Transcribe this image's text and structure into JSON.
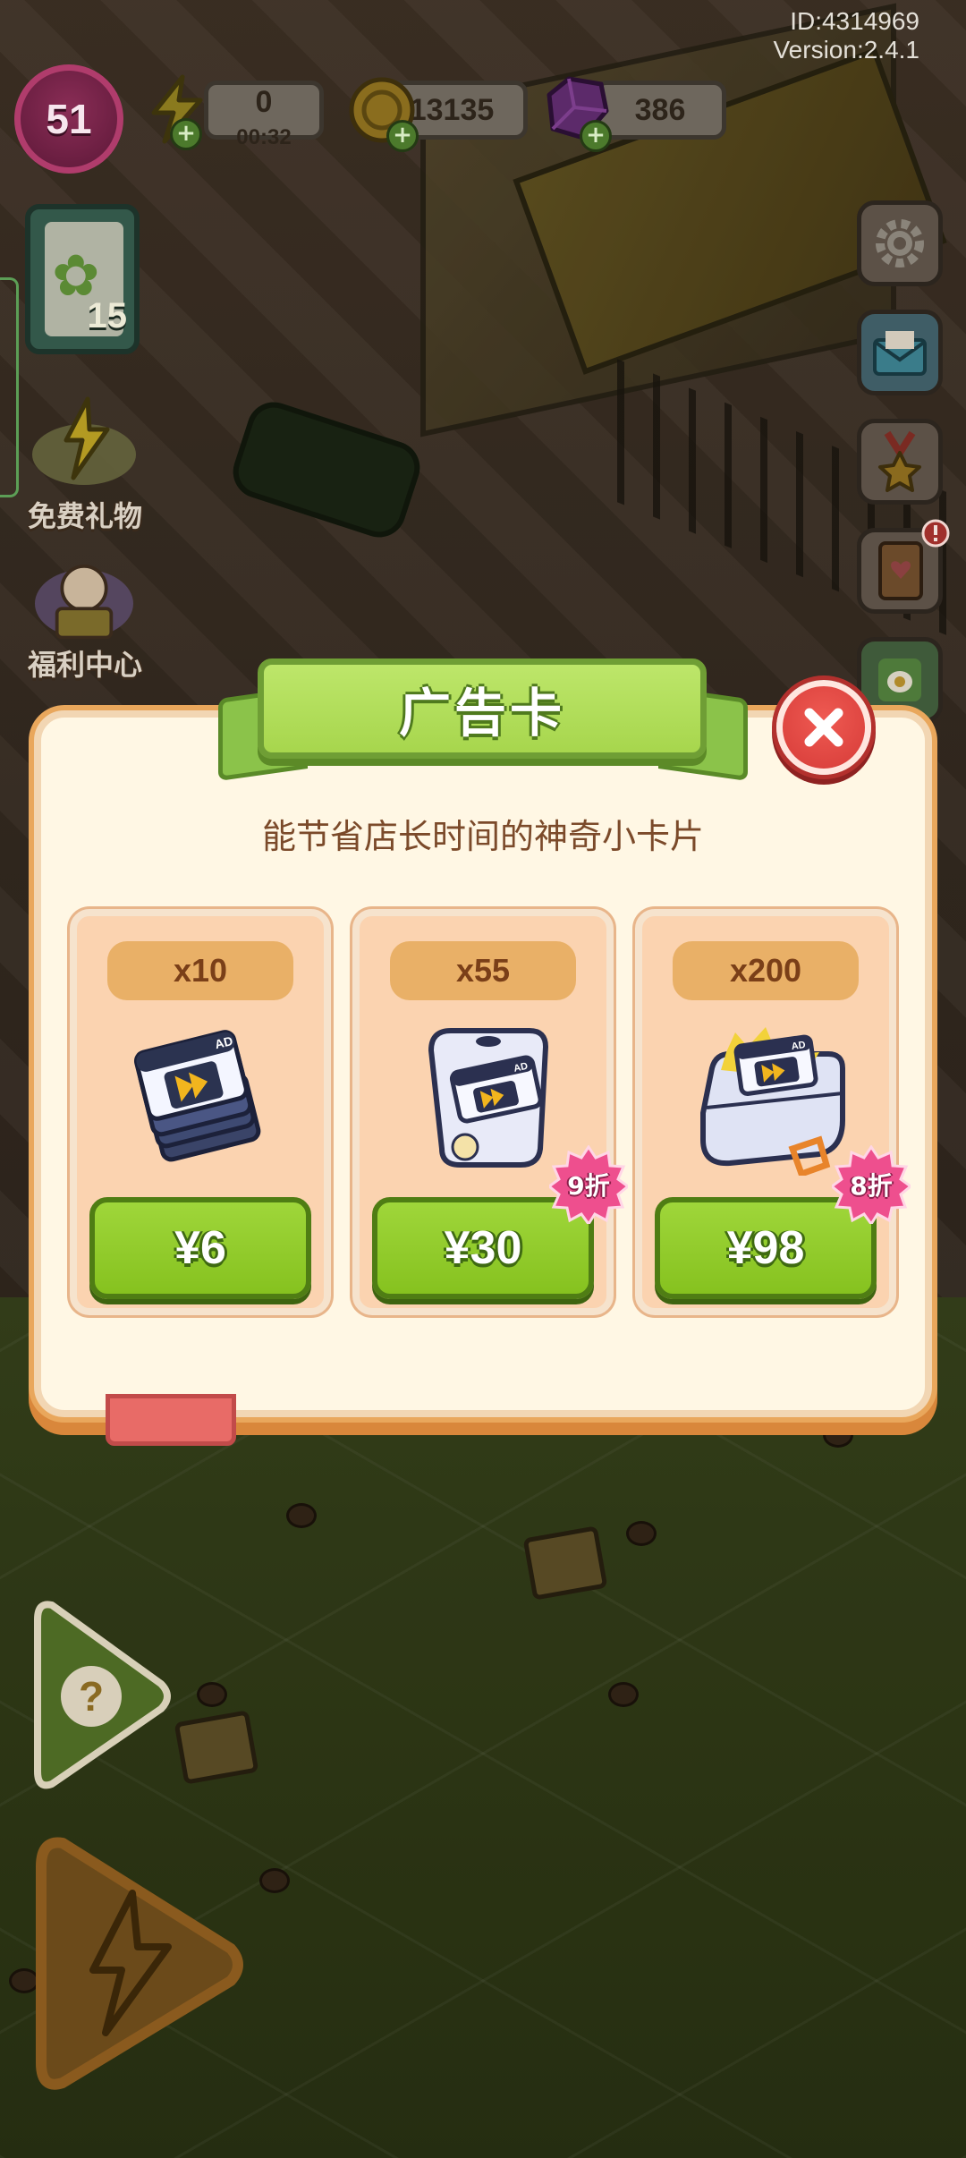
{
  "hud": {
    "id": "ID:4314969",
    "version": "Version:2.4.1",
    "level": "51",
    "energy": "0",
    "energy_timer": "00:32",
    "coins": "13135",
    "gems": "386",
    "plus_symbol": "+",
    "clipboard_count": "15"
  },
  "left_menu": {
    "free_gift": "免费礼物",
    "welfare_center": "福利中心"
  },
  "dialog": {
    "title": "广告卡",
    "subtitle": "能节省店长时间的神奇小卡片",
    "offers": [
      {
        "quantity": "x10",
        "price": "¥6",
        "discount": ""
      },
      {
        "quantity": "x55",
        "price": "¥30",
        "discount": "9折"
      },
      {
        "quantity": "x200",
        "price": "¥98",
        "discount": "8折"
      }
    ]
  },
  "colors": {
    "ribbon_green": "#a7d64d",
    "buy_green": "#86c21f",
    "close_red": "#d63b38",
    "discount_pink": "#ee4f8e",
    "panel_cream": "#fff7e4",
    "card_peach": "#fbd3b0"
  },
  "icons": [
    "energy-icon",
    "coin-icon",
    "gem-icon",
    "gear-icon",
    "mail-icon",
    "medal-icon",
    "book-icon",
    "close-icon",
    "question-icon",
    "lightning-icon",
    "ad-card-icon"
  ]
}
